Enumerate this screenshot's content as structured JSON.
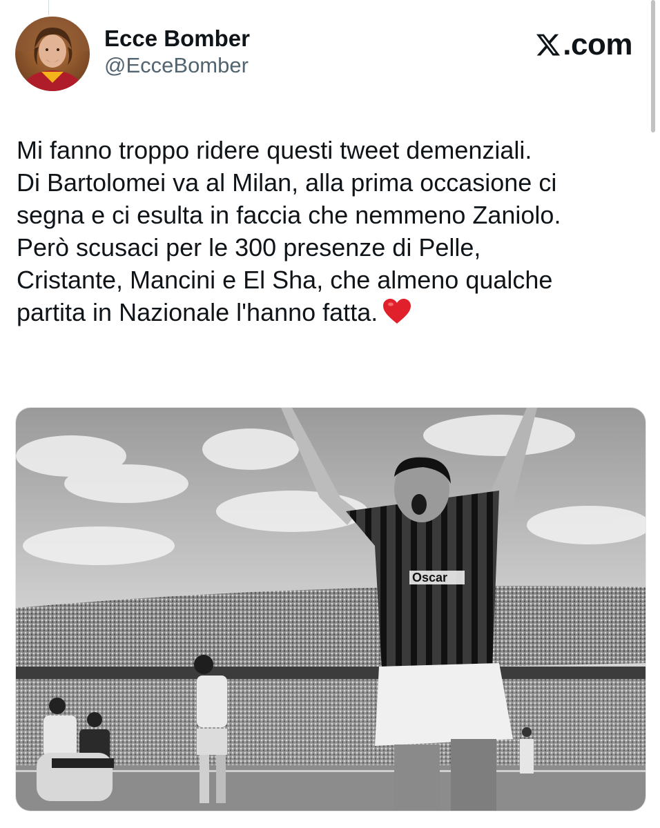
{
  "author": {
    "display_name": "Ecce Bomber",
    "handle": "@EcceBomber"
  },
  "brand": {
    "label": ".com"
  },
  "tweet": {
    "lines": [
      "Mi fanno troppo ridere questi tweet demenziali.",
      "Di Bartolomei va al Milan, alla prima occasione ci",
      "segna e ci esulta in faccia che nemmeno Zaniolo.",
      "Però scusaci per le 300 presenze di Pelle,",
      "Cristante, Mancini e El Sha, che almeno qualche",
      "partita in Nazionale l'hanno fatta."
    ],
    "emoji": "red-heart"
  },
  "media": {
    "description_icon": "photo",
    "jersey_text": "Oscar"
  },
  "colors": {
    "text": "#0f1419",
    "secondary": "#536471",
    "heart": "#e0202a"
  }
}
